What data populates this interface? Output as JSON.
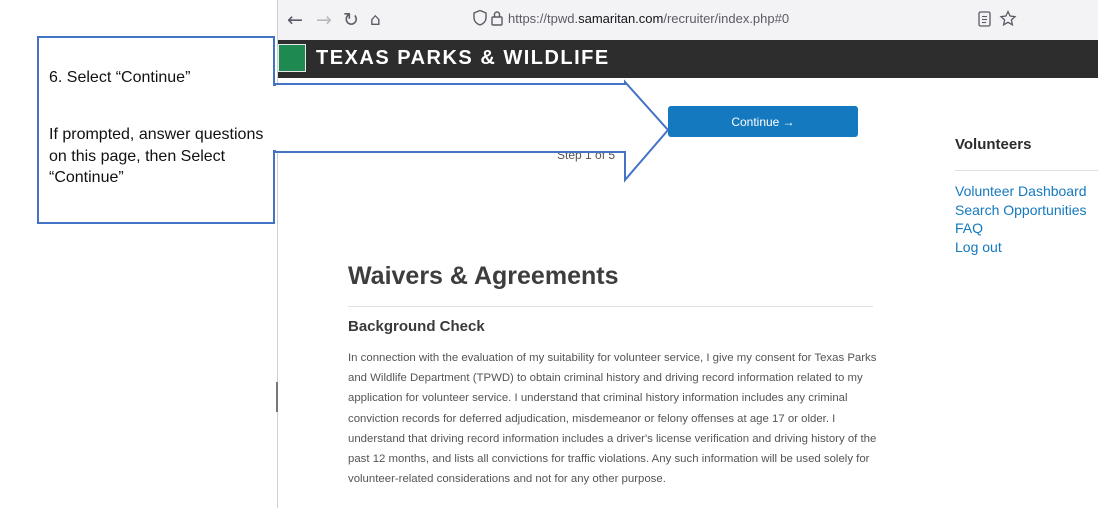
{
  "browser": {
    "url_prefix": "https://tpwd.",
    "url_domain": "samaritan.com",
    "url_suffix": "/recruiter/index.php#0",
    "icons": [
      "back-icon",
      "forward-icon",
      "reload-icon",
      "home-icon",
      "shield-icon",
      "lock-icon",
      "reader-view-icon",
      "bookmark-star-icon"
    ]
  },
  "site": {
    "title": "TEXAS PARKS & WILDLIFE",
    "brand_color": "#1e8a52"
  },
  "main": {
    "continue_label": "Continue →",
    "step_text": "Step 1 of 5",
    "heading": "Waivers & Agreements",
    "section_title": "Background Check",
    "section_text": "In connection with the evaluation of my suitability for volunteer service, I give my consent for Texas Parks and Wildlife Department (TPWD) to obtain criminal history and driving record information related to my application for volunteer service. I understand that criminal history information includes any criminal conviction records for deferred adjudication, misdemeanor or felony offenses at age 17 or older. I understand that driving record information includes a driver's license verification and driving history of the past 12 months, and lists all convictions for traffic violations. Any such information will be used solely for volunteer-related considerations and not for any other purpose."
  },
  "sidebar": {
    "title": "Volunteers",
    "links": [
      {
        "label": "Volunteer Dashboard"
      },
      {
        "label": "Search Opportunities"
      },
      {
        "label": "FAQ"
      },
      {
        "label": "Log out"
      }
    ]
  },
  "annotation": {
    "step": "6. Select “Continue”",
    "body": "If prompted, answer questions on this page, then Select “Continue”",
    "border_color": "#4472c4"
  }
}
